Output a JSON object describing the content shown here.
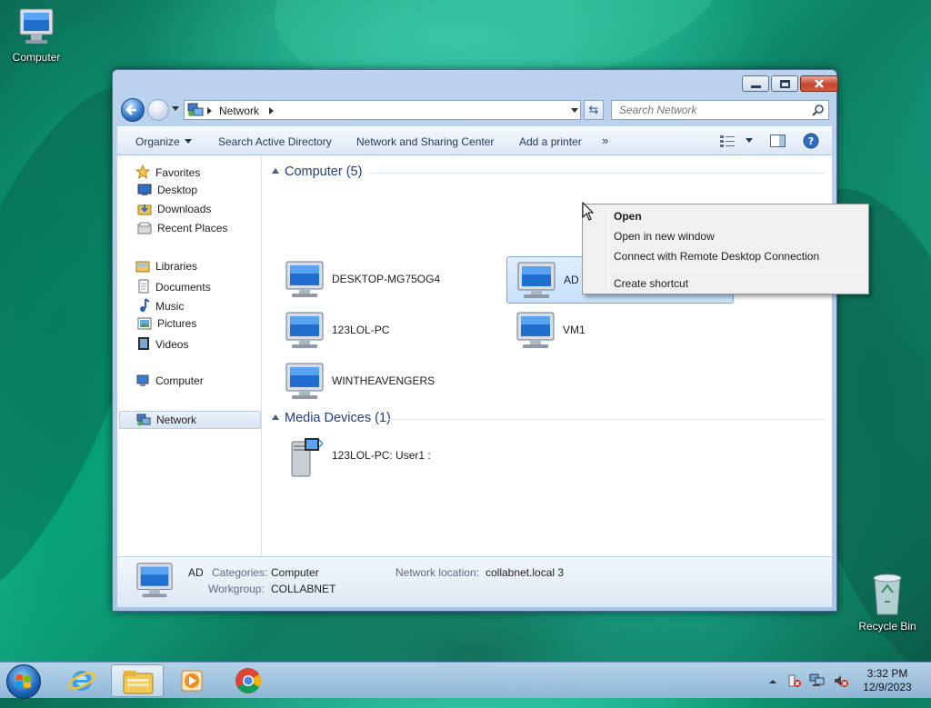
{
  "desktop": {
    "icons": [
      {
        "label": "Computer",
        "icon": "computer-icon"
      },
      {
        "label": "Recycle Bin",
        "icon": "recycle-bin-icon"
      }
    ]
  },
  "window": {
    "address": {
      "crumb": "Network"
    },
    "search": {
      "placeholder": "Search Network"
    },
    "commands": {
      "organize": "Organize",
      "search_ad": "Search Active Directory",
      "network_sharing": "Network and Sharing Center",
      "add_printer": "Add a printer",
      "more": "»"
    },
    "nav": {
      "favorites": "Favorites",
      "desktop": "Desktop",
      "downloads": "Downloads",
      "recent": "Recent Places",
      "libraries": "Libraries",
      "documents": "Documents",
      "music": "Music",
      "pictures": "Pictures",
      "videos": "Videos",
      "computer": "Computer",
      "network": "Network"
    },
    "groups": {
      "computer": {
        "heading": "Computer (5)",
        "items": [
          "DESKTOP-MG75OG4",
          "AD",
          "123LOL-PC",
          "VM1",
          "WINTHEAVENGERS"
        ]
      },
      "media": {
        "heading": "Media Devices (1)",
        "items": [
          "123LOL-PC: User1 :"
        ]
      }
    },
    "details": {
      "name": "AD",
      "categories_label": "Categories:",
      "categories_value": "Computer",
      "workgroup_label": "Workgroup:",
      "workgroup_value": "COLLABNET",
      "location_label": "Network location:",
      "location_value": "collabnet.local 3"
    }
  },
  "context_menu": {
    "open": "Open",
    "open_new": "Open in new window",
    "remote": "Connect with Remote Desktop Connection",
    "shortcut": "Create shortcut"
  },
  "taskbar": {
    "time": "3:32 PM",
    "date": "12/9/2023"
  }
}
